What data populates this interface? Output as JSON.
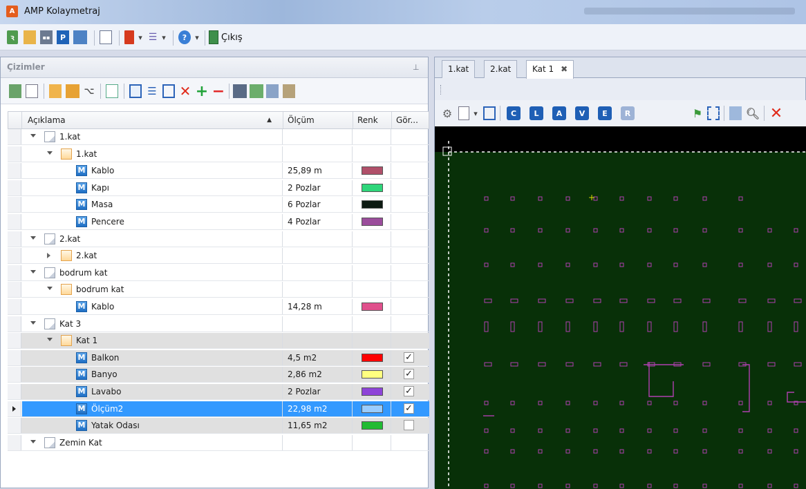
{
  "window": {
    "title": "AMP Kolaymetraj",
    "app_icon": "amp-logo-icon"
  },
  "main_toolbar": {
    "exit_label": "Çıkış",
    "buttons": [
      "refresh-icon",
      "open-icon",
      "grid-icon",
      "p-icon",
      "tiles-icon",
      "window-icon",
      "book-icon",
      "list-dropdown-icon",
      "help-icon",
      "exit-door-icon"
    ]
  },
  "left_pane": {
    "title": "Çizimler",
    "pin_icon": "pin-icon",
    "toolbar_icons": [
      "import-icon",
      "edit-icon",
      "add-folder-icon",
      "open-folder-icon",
      "tree-icon",
      "refresh-page-icon",
      "panel-icon",
      "list-icon",
      "window-icon",
      "delete-icon",
      "add-icon",
      "remove-icon",
      "print-icon",
      "clear-icon",
      "copy-icon",
      "paste-icon"
    ],
    "columns": {
      "aciklama": "Açıklama",
      "olcum": "Ölçüm",
      "renk": "Renk",
      "gor": "Gör..."
    },
    "rows": [
      {
        "indent": 0,
        "kind": "doc",
        "toggle": "open",
        "label": "1.kat",
        "value": "",
        "color": "",
        "check": "",
        "style": ""
      },
      {
        "indent": 1,
        "kind": "fold",
        "toggle": "open",
        "label": "1.kat",
        "value": "",
        "color": "",
        "check": "",
        "style": ""
      },
      {
        "indent": 2,
        "kind": "m",
        "toggle": "",
        "label": "Kablo",
        "value": "25,89 m",
        "color": "#b0506a",
        "check": "",
        "style": ""
      },
      {
        "indent": 2,
        "kind": "m",
        "toggle": "",
        "label": "Kapı",
        "value": "2 Pozlar",
        "color": "#2ed67a",
        "check": "",
        "style": ""
      },
      {
        "indent": 2,
        "kind": "m",
        "toggle": "",
        "label": "Masa",
        "value": "6 Pozlar",
        "color": "#0d1a12",
        "check": "",
        "style": ""
      },
      {
        "indent": 2,
        "kind": "m",
        "toggle": "",
        "label": "Pencere",
        "value": "4 Pozlar",
        "color": "#9b4d9c",
        "check": "",
        "style": ""
      },
      {
        "indent": 0,
        "kind": "doc",
        "toggle": "open",
        "label": "2.kat",
        "value": "",
        "color": "",
        "check": "",
        "style": ""
      },
      {
        "indent": 1,
        "kind": "fold",
        "toggle": "closed",
        "label": "2.kat",
        "value": "",
        "color": "",
        "check": "",
        "style": ""
      },
      {
        "indent": 0,
        "kind": "doc",
        "toggle": "open",
        "label": "bodrum kat",
        "value": "",
        "color": "",
        "check": "",
        "style": ""
      },
      {
        "indent": 1,
        "kind": "fold",
        "toggle": "open",
        "label": "bodrum kat",
        "value": "",
        "color": "",
        "check": "",
        "style": ""
      },
      {
        "indent": 2,
        "kind": "m",
        "toggle": "",
        "label": "Kablo",
        "value": "14,28 m",
        "color": "#e0508c",
        "check": "",
        "style": ""
      },
      {
        "indent": 0,
        "kind": "doc",
        "toggle": "open",
        "label": "Kat 3",
        "value": "",
        "color": "",
        "check": "",
        "style": ""
      },
      {
        "indent": 1,
        "kind": "fold",
        "toggle": "open",
        "label": "Kat 1",
        "value": "",
        "color": "",
        "check": "",
        "style": "gray"
      },
      {
        "indent": 2,
        "kind": "m",
        "toggle": "",
        "label": "Balkon",
        "value": "4,5 m2",
        "color": "#ff0000",
        "check": "✓",
        "style": "gray"
      },
      {
        "indent": 2,
        "kind": "m",
        "toggle": "",
        "label": "Banyo",
        "value": "2,86 m2",
        "color": "#ffff80",
        "check": "✓",
        "style": "gray"
      },
      {
        "indent": 2,
        "kind": "m",
        "toggle": "",
        "label": "Lavabo",
        "value": "2 Pozlar",
        "color": "#8e44d8",
        "check": "✓",
        "style": "gray"
      },
      {
        "indent": 2,
        "kind": "m",
        "toggle": "",
        "label": "Ölçüm2",
        "value": "22,98 m2",
        "color": "#99ccff",
        "check": "✓",
        "style": "sel"
      },
      {
        "indent": 2,
        "kind": "m",
        "toggle": "",
        "label": "Yatak Odası",
        "value": "11,65 m2",
        "color": "#22bb33",
        "check": " ",
        "style": "gray"
      },
      {
        "indent": 0,
        "kind": "doc",
        "toggle": "open",
        "label": "Zemin Kat",
        "value": "",
        "color": "",
        "check": "",
        "style": ""
      }
    ]
  },
  "right_pane": {
    "tabs": [
      {
        "label": "1.kat",
        "active": false
      },
      {
        "label": "2.kat",
        "active": false
      },
      {
        "label": "Kat 1",
        "active": true
      }
    ],
    "close_glyph": "✖",
    "toolbar_letters": [
      "C",
      "L",
      "A",
      "V",
      "E",
      "R"
    ],
    "toolbar_icons": [
      "layers-icon",
      "page-dropdown-icon",
      "window-icon",
      "flag-icon",
      "select-rect-icon",
      "image-icon",
      "zoom-icon",
      "delete-icon"
    ],
    "canvas_color": "#083008"
  }
}
